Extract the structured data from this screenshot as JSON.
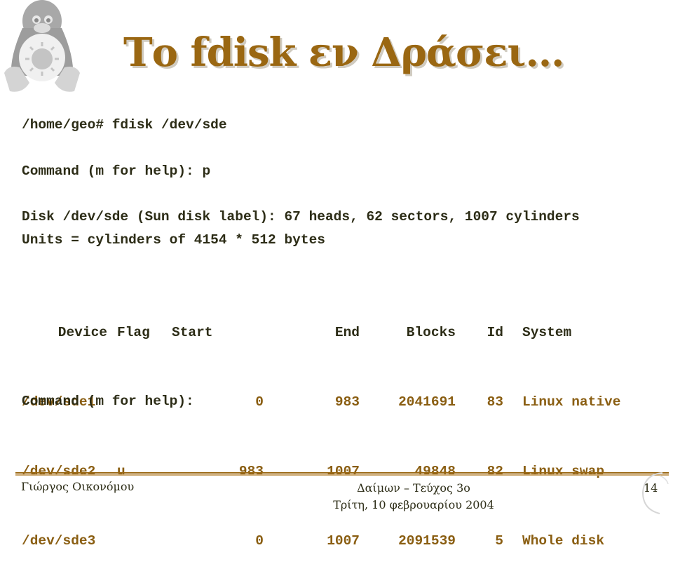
{
  "slide": {
    "title": "Το fdisk εν Δράσει…",
    "logo": "tux-penguin-icon",
    "accent_color": "#9a6712",
    "text_color": "#2c2c16"
  },
  "terminal": {
    "lines": [
      "/home/geo# fdisk /dev/sde",
      "Command (m for help): p",
      "Disk /dev/sde (Sun disk label): 67 heads, 62 sectors, 1007 cylinders",
      "Units = cylinders of 4154 * 512 bytes"
    ],
    "table": {
      "headers": [
        "Device",
        "Flag",
        "Start",
        "End",
        "Blocks",
        "Id",
        "System"
      ],
      "rows": [
        {
          "device": "/dev/sde1",
          "flag": "",
          "start": "0",
          "end": "983",
          "blocks": "2041691",
          "id": "83",
          "system": "Linux native"
        },
        {
          "device": "/dev/sde2",
          "flag": "u",
          "start": "983",
          "end": "1007",
          "blocks": "49848",
          "id": "82",
          "system": "Linux swap"
        },
        {
          "device": "/dev/sde3",
          "flag": "",
          "start": "0",
          "end": "1007",
          "blocks": "2091539",
          "id": "5",
          "system": "Whole disk"
        }
      ]
    },
    "final_prompt": "Command (m for help):"
  },
  "footer": {
    "author": "Γιώργος Οικονόμου",
    "issue": "Δαίμων – Τεύχος 3ο",
    "date": "Τρίτη, 10 φεβρουαρίου 2004",
    "page_number": "14"
  }
}
